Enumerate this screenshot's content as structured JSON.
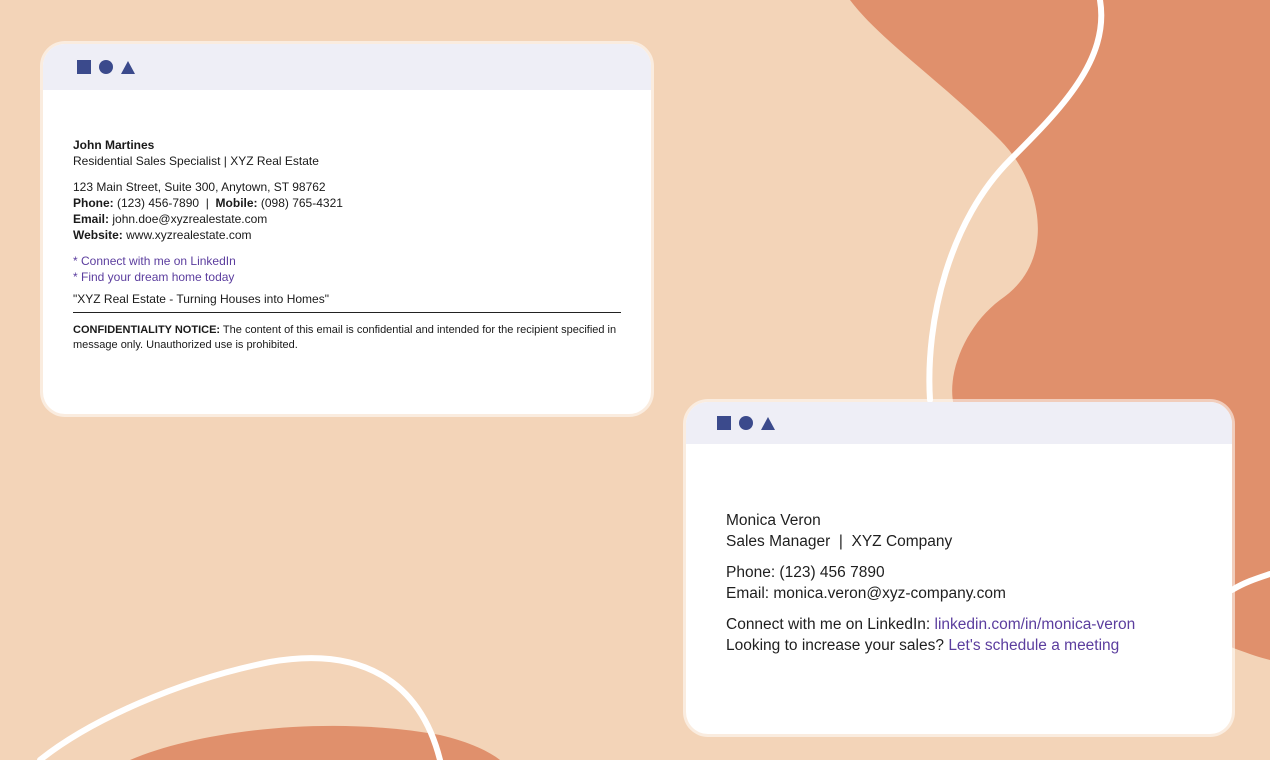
{
  "card1": {
    "name": "John Martines",
    "title": "Residential Sales Specialist | XYZ Real Estate",
    "address": "123 Main Street, Suite 300, Anytown, ST 98762",
    "phone_label": "Phone:",
    "phone": " (123) 456-7890",
    "sep": "  |  ",
    "mobile_label": "Mobile:",
    "mobile": " (098) 765-4321",
    "email_label": "Email:",
    "email": " john.doe@xyzrealestate.com",
    "website_label": "Website:",
    "website": " www.xyzrealestate.com",
    "link1": "* Connect with me on LinkedIn",
    "link2": "* Find your dream home today",
    "tagline": "\"XYZ Real Estate - Turning Houses into Homes\"",
    "notice_label": "CONFIDENTIALITY NOTICE:",
    "notice_text": " The content of this email is confidential and intended for the recipient specified in message only. Unauthorized use is prohibited."
  },
  "card2": {
    "name": "Monica Veron",
    "title": "Sales Manager  |  XYZ Company",
    "phone": "Phone: (123) 456 7890",
    "email": "Email: monica.veron@xyz-company.com",
    "linkedin_prefix": "Connect with me on LinkedIn: ",
    "linkedin_link": "linkedin.com/in/monica-veron",
    "cta_prefix": "Looking to increase your sales? ",
    "cta_link": "Let's schedule a meeting"
  },
  "colors": {
    "background": "#f3d4b8",
    "blob": "#e0906c",
    "window_bar": "#eeeef6",
    "icon": "#3b4a8c",
    "link": "#5b3d9e"
  }
}
